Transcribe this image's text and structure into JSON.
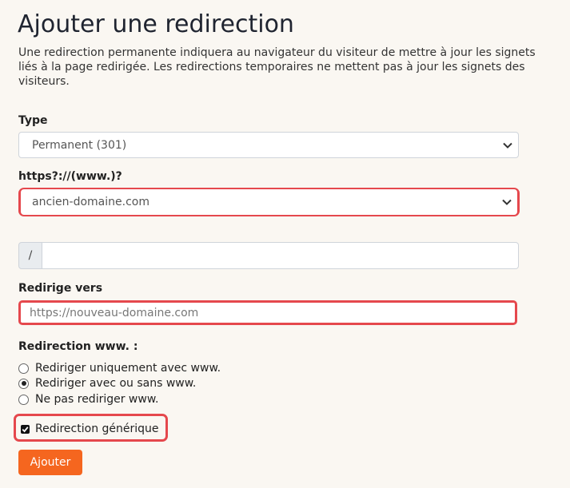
{
  "page": {
    "title": "Ajouter une redirection",
    "intro": "Une redirection permanente indiquera au navigateur du visiteur de mettre à jour les signets liés à la page redirigée. Les redirections temporaires ne mettent pas à jour les signets des visiteurs."
  },
  "form": {
    "type": {
      "label": "Type",
      "value": "Permanent (301)"
    },
    "domain": {
      "label": "https?://(www.)?",
      "value": "ancien-domaine.com"
    },
    "path": {
      "prefix": "/",
      "value": ""
    },
    "target": {
      "label": "Redirige vers",
      "placeholder": "https://nouveau-domaine.com"
    },
    "www": {
      "label": "Redirection www. :",
      "options": [
        {
          "label": "Rediriger uniquement avec www.",
          "selected": false
        },
        {
          "label": "Rediriger avec ou sans www.",
          "selected": true
        },
        {
          "label": "Ne pas rediriger www.",
          "selected": false
        }
      ]
    },
    "wildcard": {
      "label": "Redirection générique",
      "checked": true
    },
    "submit_label": "Ajouter"
  },
  "colors": {
    "accent": "#f5661f",
    "highlight": "#e5484d",
    "background": "#faf7f2"
  }
}
